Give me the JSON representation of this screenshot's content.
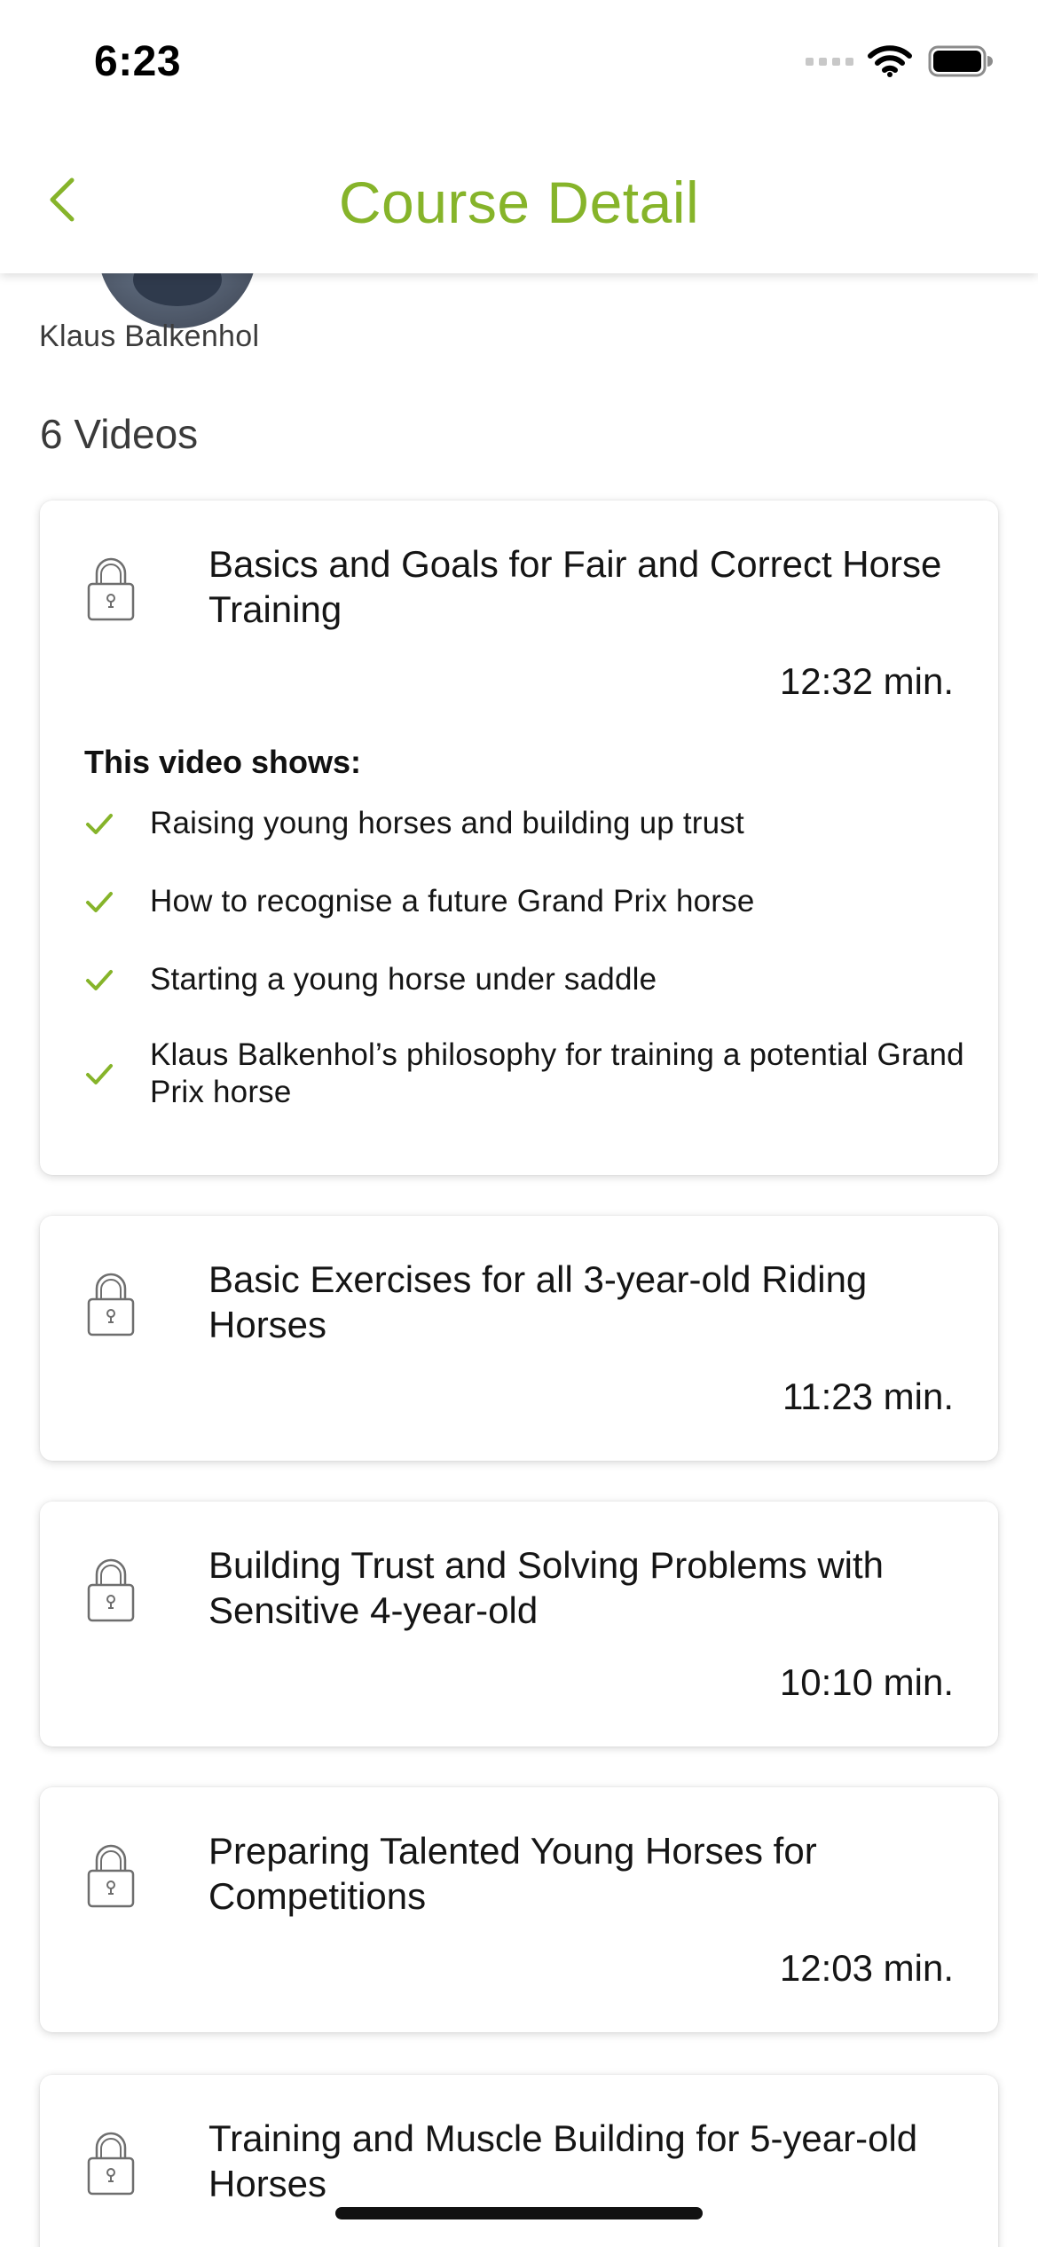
{
  "status_bar": {
    "time": "6:23"
  },
  "nav": {
    "title": "Course Detail"
  },
  "instructor": {
    "name": "Klaus Balkenhol"
  },
  "videos_count_label": "6 Videos",
  "videos": [
    {
      "title": "Basics and Goals for Fair and Correct Horse Training",
      "duration": "12:32 min.",
      "locked": true,
      "shows_heading": "This video shows:",
      "shows": [
        "Raising young horses and building up trust",
        "How to recognise a future Grand Prix horse",
        "Starting a young horse under saddle",
        "Klaus Balkenhol’s philosophy for training a potential Grand Prix horse"
      ]
    },
    {
      "title": "Basic Exercises for all 3-year-old Riding Horses",
      "duration": "11:23 min.",
      "locked": true
    },
    {
      "title": "Building Trust and Solving Problems with Sensitive 4-year-old",
      "duration": "10:10 min.",
      "locked": true
    },
    {
      "title": "Preparing Talented Young Horses for Competitions",
      "duration": "12:03 min.",
      "locked": true
    },
    {
      "title": "Training and Muscle Building for 5-year-old Horses",
      "locked": true
    }
  ],
  "colors": {
    "accent": "#86b42a",
    "text": "#151515",
    "background": "#ffffff"
  },
  "icons": {
    "back": "chevron-left-icon",
    "lock": "lock-icon",
    "check": "checkmark-icon",
    "wifi": "wifi-icon",
    "signal": "cellular-signal-icon",
    "battery": "battery-icon"
  }
}
